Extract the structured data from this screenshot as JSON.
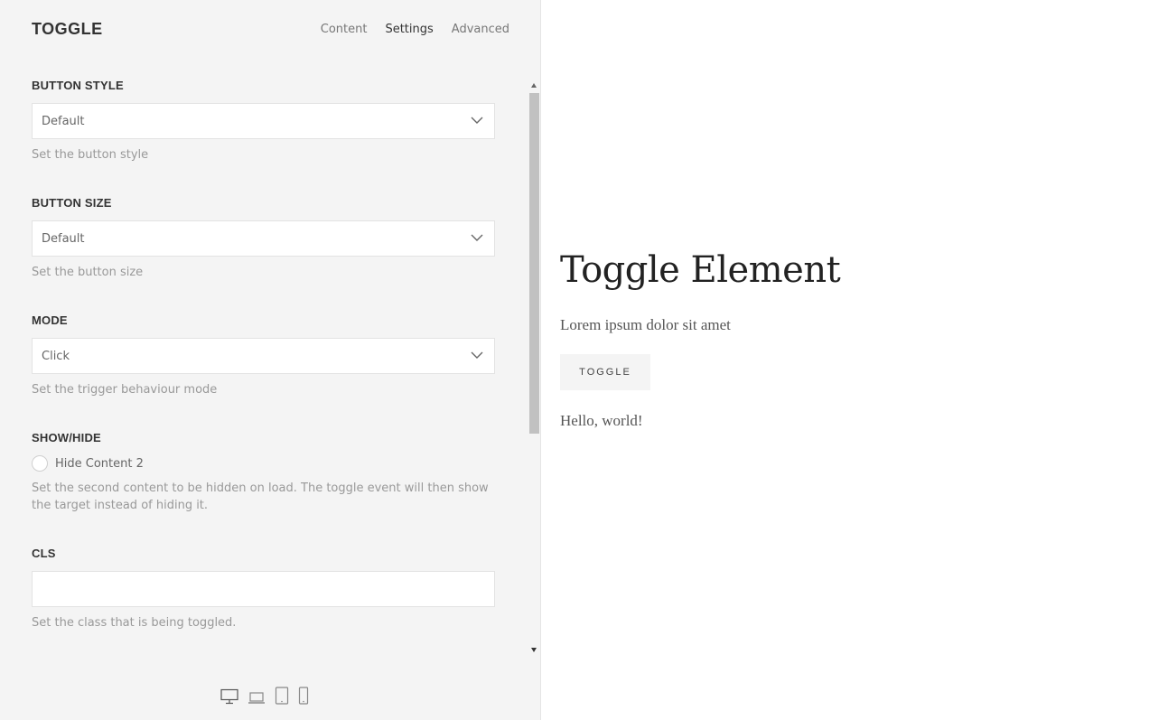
{
  "panel": {
    "title": "TOGGLE",
    "tabs": [
      {
        "label": "Content"
      },
      {
        "label": "Settings",
        "active": true
      },
      {
        "label": "Advanced"
      }
    ]
  },
  "fields": {
    "button_style": {
      "label": "BUTTON STYLE",
      "value": "Default",
      "help": "Set the button style"
    },
    "button_size": {
      "label": "BUTTON SIZE",
      "value": "Default",
      "help": "Set the button size"
    },
    "mode": {
      "label": "MODE",
      "value": "Click",
      "help": "Set the trigger behaviour mode"
    },
    "show_hide": {
      "label": "SHOW/HIDE",
      "checkbox_label": "Hide Content 2",
      "checked": false,
      "help": "Set the second content to be hidden on load. The toggle event will then show the target instead of hiding it."
    },
    "cls": {
      "label": "CLS",
      "value": "",
      "help": "Set the class that is being toggled."
    }
  },
  "devices": [
    "desktop-icon",
    "laptop-icon",
    "tablet-icon",
    "phone-icon"
  ],
  "preview": {
    "title": "Toggle Element",
    "text": "Lorem ipsum dolor sit amet",
    "button_label": "TOGGLE",
    "hello": "Hello, world!"
  }
}
